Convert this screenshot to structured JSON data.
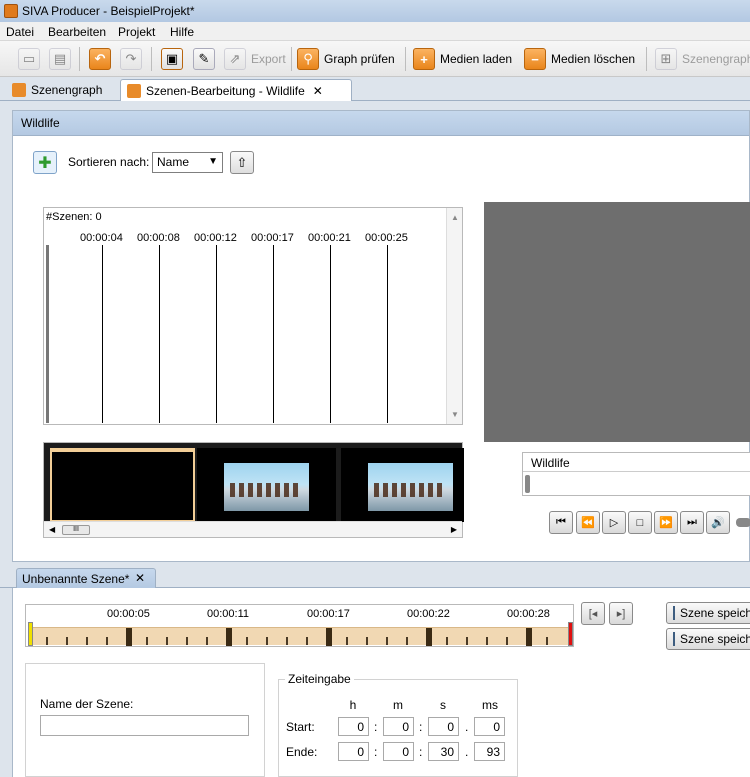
{
  "window": {
    "title": "SIVA Producer - BeispielProjekt*"
  },
  "menu": {
    "items": [
      "Datei",
      "Bearbeiten",
      "Projekt",
      "Hilfe"
    ]
  },
  "toolbar": {
    "export_label": "Export",
    "graph_check_label": "Graph prüfen",
    "media_load_label": "Medien laden",
    "media_delete_label": "Medien löschen",
    "scenegraph_label": "Szenengraph"
  },
  "editor_tabs": [
    {
      "label": "Szenengraph"
    },
    {
      "label": "Szenen-Bearbeitung -  Wildlife"
    }
  ],
  "panel": {
    "title": "Wildlife"
  },
  "sort": {
    "label": "Sortieren nach:",
    "selected": "Name"
  },
  "scene_list": {
    "count_label": "#Szenen: 0",
    "timestamps": [
      "00:00:04",
      "00:00:08",
      "00:00:12",
      "00:00:17",
      "00:00:21",
      "00:00:25"
    ]
  },
  "filmstrip": {
    "scroll_thumb_label": "III"
  },
  "media": {
    "name": "Wildlife"
  },
  "player": {
    "icons": [
      "skip-start-icon",
      "step-back-icon",
      "play-icon",
      "stop-icon",
      "step-forward-icon",
      "skip-end-icon",
      "volume-icon"
    ]
  },
  "scene_tab": {
    "label": "Unbenannte Szene*"
  },
  "ruler": {
    "timestamps": [
      "00:00:05",
      "00:00:11",
      "00:00:17",
      "00:00:22",
      "00:00:28"
    ]
  },
  "buttons": {
    "save_scene_1": "Szene speichern",
    "save_scene_2": "Szene speichern"
  },
  "scene_name": {
    "label": "Name der Szene:",
    "value": ""
  },
  "time_entry": {
    "title": "Zeiteingabe",
    "columns": [
      "h",
      "m",
      "s",
      "ms"
    ],
    "start_label": "Start:",
    "end_label": "Ende:",
    "start": {
      "h": "0",
      "m": "0",
      "s": "0",
      "ms": "0"
    },
    "end": {
      "h": "0",
      "m": "0",
      "s": "30",
      "ms": "93"
    }
  },
  "colors": {
    "accent_orange": "#e9851b",
    "ruler_band": "#f1d8b3",
    "video_bg": "#6e6e6e"
  }
}
